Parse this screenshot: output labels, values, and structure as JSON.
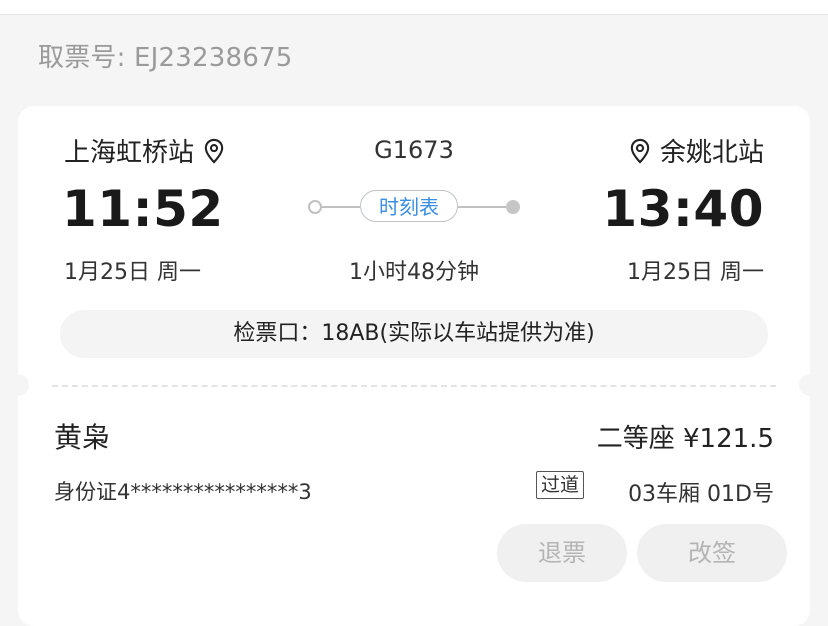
{
  "header": {
    "order_label": "取票号: EJ23238675"
  },
  "trip": {
    "from_station": "上海虹桥站",
    "to_station": "余姚北站",
    "train_no": "G1673",
    "dep_time": "11:52",
    "arr_time": "13:40",
    "schedule_label": "时刻表",
    "dep_date": "1月25日 周一",
    "arr_date": "1月25日 周一",
    "duration": "1小时48分钟",
    "gate": "检票口：18AB(实际以车站提供为准)"
  },
  "passenger": {
    "name": "黄枭",
    "seat_price": "二等座 ¥121.5",
    "id_no": "身份证4****************3",
    "status_tag": "过道",
    "car_seat": "03车厢 01D号"
  },
  "actions": {
    "refund_label": "退票",
    "change_label": "改签"
  },
  "colors": {
    "accent": "#3a8ee6",
    "muted": "#9a9a9a",
    "disabled_text": "#b4b4b4",
    "background": "#f5f5f5"
  },
  "icons": {
    "from_station": "location-pin-icon",
    "to_station": "location-pin-icon"
  }
}
